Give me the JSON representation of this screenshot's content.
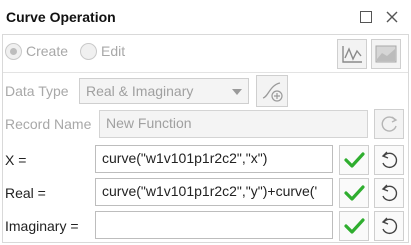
{
  "window": {
    "title": "Curve Operation"
  },
  "mode": {
    "create_label": "Create",
    "edit_label": "Edit"
  },
  "data_type": {
    "label": "Data Type",
    "selected": "Real & Imaginary"
  },
  "record_name": {
    "label": "Record Name",
    "value": "New Function"
  },
  "fields": [
    {
      "label": "X =",
      "value": "curve(\"w1v101p1r2c2\",\"x\")"
    },
    {
      "label": "Real =",
      "value": "curve(\"w1v101p1r2c2\",\"y\")+curve('"
    },
    {
      "label": "Imaginary =",
      "value": ""
    }
  ],
  "colors": {
    "check_green": "#2fae2f",
    "disabled_text": "#a8a8a8"
  }
}
